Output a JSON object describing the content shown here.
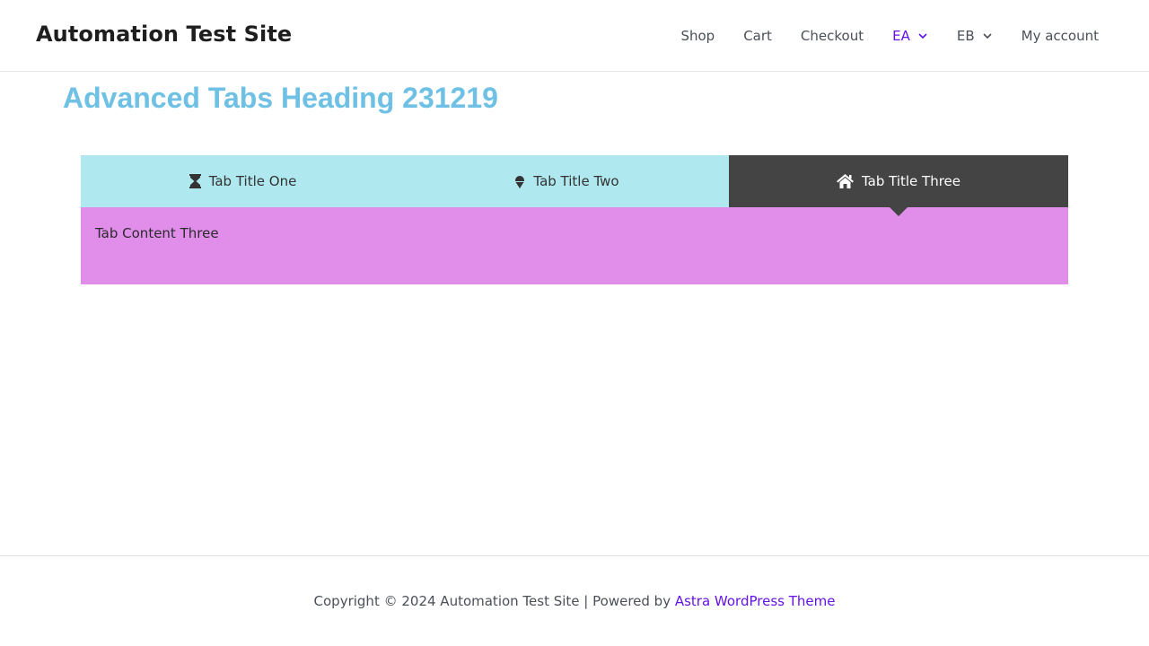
{
  "site": {
    "title": "Automation Test Site"
  },
  "nav": {
    "items": [
      {
        "label": "Shop"
      },
      {
        "label": "Cart"
      },
      {
        "label": "Checkout"
      },
      {
        "label": "EA"
      },
      {
        "label": "EB"
      },
      {
        "label": "My account"
      }
    ],
    "active_color": "#6412e6"
  },
  "heading": "Advanced Tabs Heading 231219",
  "tabs": {
    "items": [
      {
        "label": "Tab Title One",
        "icon": "hourglass-icon"
      },
      {
        "label": "Tab Title Two",
        "icon": "ice-cream-icon"
      },
      {
        "label": "Tab Title Three",
        "icon": "home-icon"
      }
    ],
    "active_index": 2,
    "content": "Tab Content Three"
  },
  "footer": {
    "prefix": "Copyright © 2024 Automation Test Site | Powered by ",
    "link": "Astra WordPress Theme"
  },
  "colors": {
    "heading": "#6ec1e4",
    "tab_inactive_bg": "#b0e8ef",
    "tab_active_bg": "#444444",
    "content_bg": "#e08eea",
    "link": "#6412e6"
  }
}
